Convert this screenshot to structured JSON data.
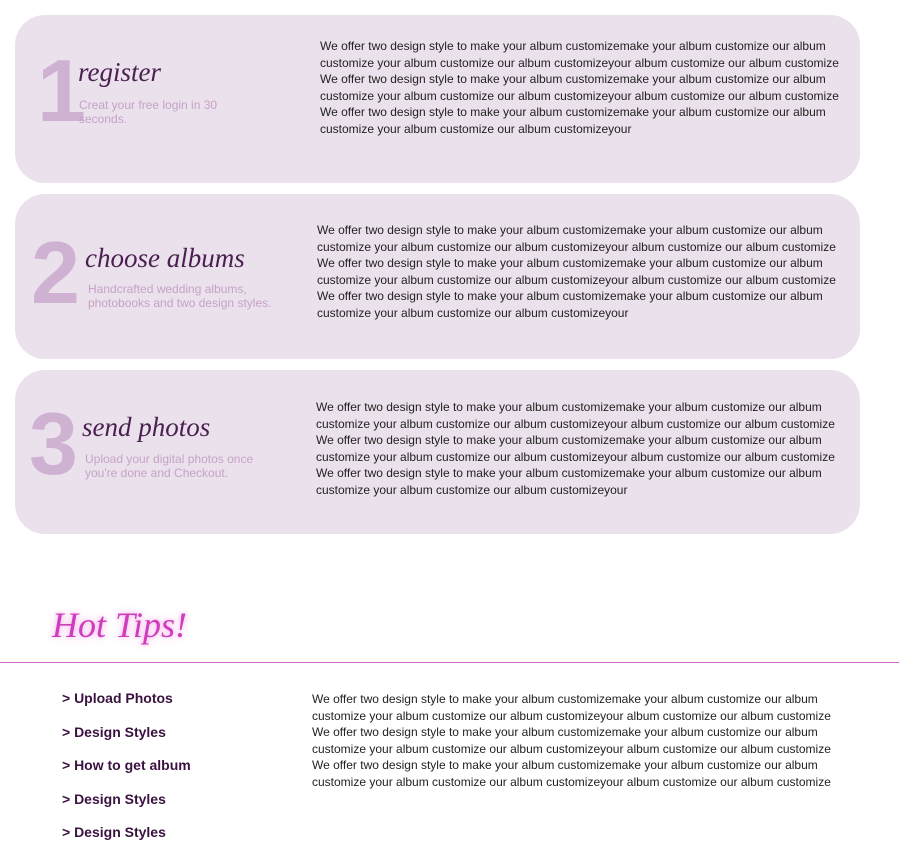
{
  "steps": [
    {
      "number": "1",
      "title": "register",
      "subtitle": "Creat your free login in 30 seconds.",
      "body": "We offer two design style to make your album customizemake your album customize our album customize your album customize our album customizeyour album customize our album customize We offer two design style to make your album customizemake your album customize our album customize your album customize our album customizeyour album customize our album customize We offer two design style to make your album customizemake your album customize our album customize your album customize our album customizeyour"
    },
    {
      "number": "2",
      "title": "choose albums",
      "subtitle": "Handcrafted wedding albums, photobooks and two design styles.",
      "body": "We offer two design style to make your album customizemake your album customize our album customize your album customize our album customizeyour album customize our album customize We offer two design style to make your album customizemake your album customize our album customize your album customize our album customizeyour album customize our album customize We offer two design style to make your album customizemake your album customize our album customize your album customize our album customizeyour"
    },
    {
      "number": "3",
      "title": "send photos",
      "subtitle": "Upload your digital photos once you're done and Checkout.",
      "body": "We offer two design style to make your album customizemake your album customize our album customize your album customize our album customizeyour album customize our album customize We offer two design style to make your album customizemake your album customize our album customize your album customize our album customizeyour album customize our album customize We offer two design style to make your album customizemake your album customize our album customize your album customize our album customizeyour"
    }
  ],
  "hot_tips": {
    "title": "Hot Tips!",
    "links": [
      "> Upload Photos",
      "> Design Styles",
      "> How to get album",
      "> Design Styles",
      "> Design Styles"
    ],
    "body": "We offer two design style to make your album customizemake your album customize our album customize your album customize our album customizeyour album customize our album customize We offer two design style to make your album customizemake your album customize our album customize your album customize our album customizeyour album customize our album customize We offer two design style to make your album customizemake your album customize our album customize your album customize our album customizeyour album customize our album customize"
  },
  "colors": {
    "card_bg": "#ebe1ec",
    "number": "#cfb2d2",
    "title": "#4a2050",
    "subtitle": "#c4a3c6",
    "accent": "#cf3dbd",
    "rule": "#d06bc4",
    "link": "#3a1240"
  }
}
